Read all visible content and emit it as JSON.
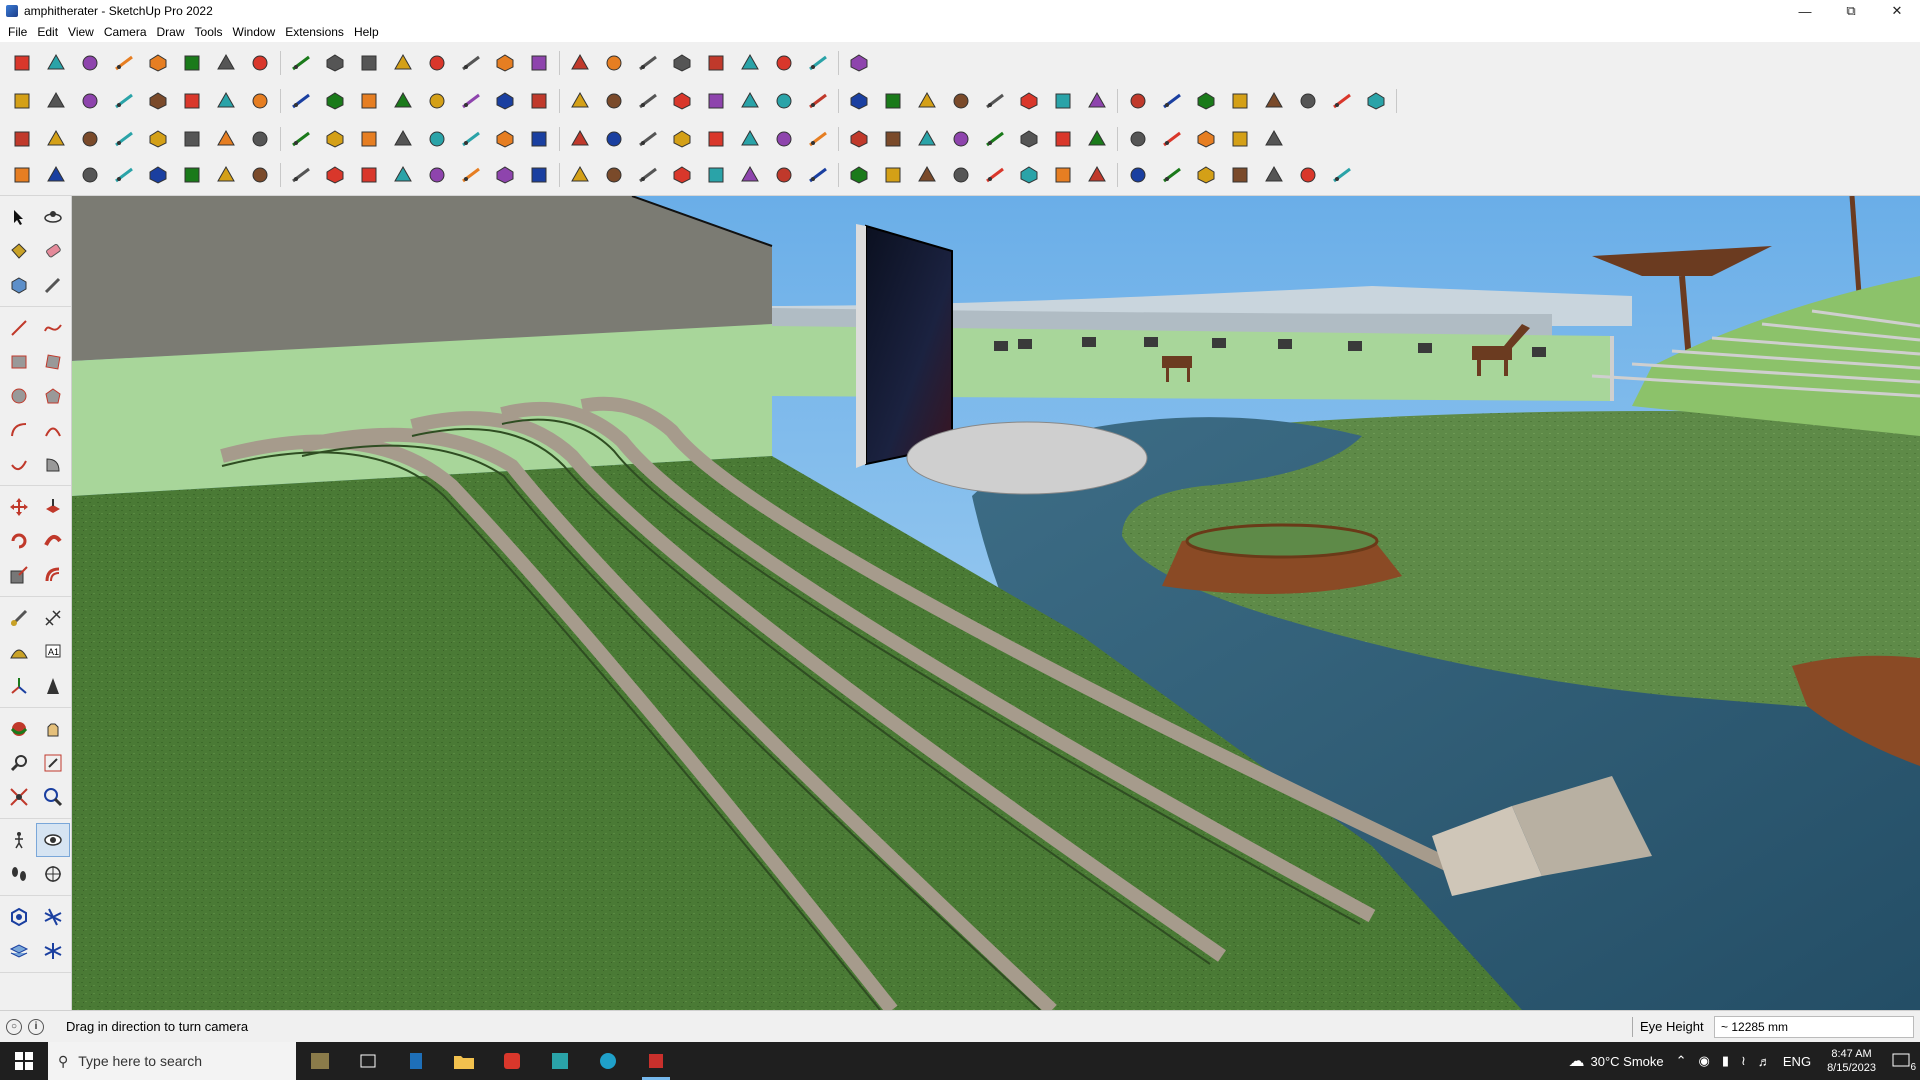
{
  "window": {
    "title": "amphitherater - SketchUp Pro 2022",
    "controls": [
      "minimize",
      "restore",
      "close"
    ]
  },
  "menu": [
    "File",
    "Edit",
    "View",
    "Camera",
    "Draw",
    "Tools",
    "Window",
    "Extensions",
    "Help"
  ],
  "toolbars": {
    "row1": [
      "search",
      "select",
      "eraser",
      "pencil",
      "lasso",
      "texture",
      "push-pull",
      "follow-me",
      "move",
      "rotate",
      "scale",
      "tape-measure",
      "text",
      "paint-bucket",
      "orbit",
      "pan",
      "zoom",
      "zoom-extents",
      "section",
      "layers",
      "components",
      "styles",
      "undo",
      "redo",
      "help"
    ],
    "row2": [
      "box",
      "cube",
      "sphere",
      "push",
      "arrow-down",
      "arrow-right",
      "arrow-green",
      "arrow-orange",
      "arrow-magenta",
      "arc",
      "line-blue",
      "line-blue-2",
      "line-blue-3",
      "paint",
      "terrain",
      "house",
      "house-2",
      "house-3",
      "house-4",
      "house-5",
      "function",
      "cursor",
      "brush",
      "shape-1",
      "shape-2",
      "shape-3",
      "shape-4",
      "shape-5",
      "shape-6",
      "shape-7",
      "shape-8",
      "shape-9",
      "shape-10",
      "shape-11",
      "shape-12",
      "shape-13",
      "shape-14",
      "shape-15",
      "shape-16",
      "shape-17"
    ],
    "row3": [
      "plane-blue",
      "plane-blue-2",
      "plane-yellow",
      "text-component",
      "plane-red",
      "plane-grey",
      "rotate-orange",
      "rect-red",
      "list",
      "page",
      "box-brown",
      "link",
      "curve",
      "dots",
      "cross",
      "x-blue",
      "cone",
      "bell",
      "warning",
      "loop",
      "loop-2",
      "loop-3",
      "arrows",
      "bucket",
      "magnet",
      "component",
      "component-2",
      "component-3",
      "gear",
      "camera",
      "window",
      "grid-orange",
      "grid-orange-2",
      "grid-orange-3",
      "x-red",
      "arc-dots",
      "grid-dots"
    ],
    "row4": [
      "dots-line",
      "dots-curve",
      "car",
      "ruby",
      "shape-a",
      "shape-b",
      "shape-c",
      "shape-d",
      "shape-e",
      "shape-f",
      "line-1",
      "line-2",
      "line-3",
      "line-4",
      "pipe",
      "stairs",
      "arrow-1",
      "arrow-2",
      "arrow-3",
      "arrow-4",
      "arrow-5",
      "arrow-6",
      "stairs-2",
      "stairs-3",
      "stairs-4",
      "stairs-5",
      "stairs-6",
      "stairs-7",
      "stairs-8",
      "stairs-9",
      "stairs-10",
      "stairs-11",
      "stairs-12",
      "stairs-13",
      "stairs-14",
      "stairs-15",
      "stairs-16",
      "stairs-17",
      "stairs-18"
    ]
  },
  "status": {
    "hint": "Drag in direction to turn camera",
    "eye_height_label": "Eye Height",
    "eye_height_value": "~ 12285 mm"
  },
  "taskbar": {
    "search_placeholder": "Type here to search",
    "weather": "30°C  Smoke",
    "language": "ENG",
    "time": "8:47 AM",
    "date": "8/15/2023",
    "notifications": "6"
  },
  "colors": {
    "sky": "#87bff0",
    "grass": "#4a7a35",
    "wall": "#7a7a72",
    "water": "#2f5f7a",
    "planter": "#8a4a25"
  }
}
